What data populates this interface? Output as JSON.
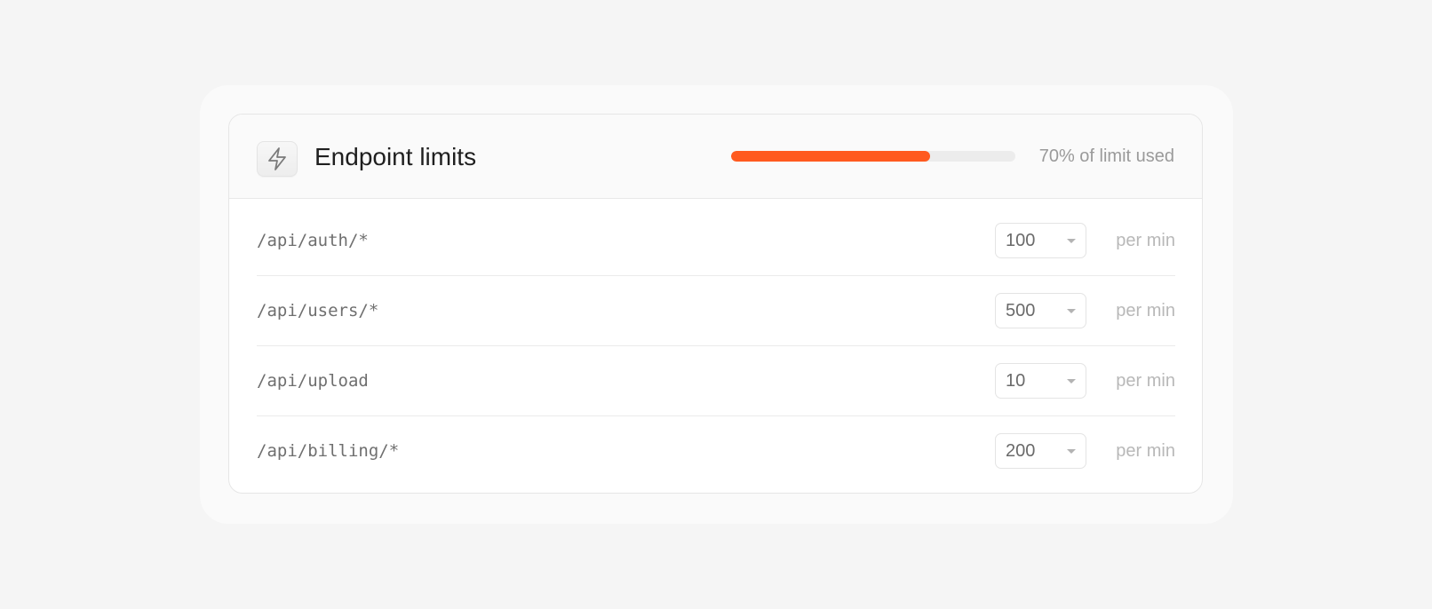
{
  "card": {
    "title": "Endpoint limits",
    "icon": "lightning-bolt-icon",
    "usage": {
      "fraction": 0.7,
      "label": "70% of limit used",
      "fill_color": "#ff5a1f"
    }
  },
  "rows": [
    {
      "endpoint": "/api/auth/*",
      "value": "100",
      "unit": "per min"
    },
    {
      "endpoint": "/api/users/*",
      "value": "500",
      "unit": "per min"
    },
    {
      "endpoint": "/api/upload",
      "value": "10",
      "unit": "per min"
    },
    {
      "endpoint": "/api/billing/*",
      "value": "200",
      "unit": "per min"
    }
  ]
}
